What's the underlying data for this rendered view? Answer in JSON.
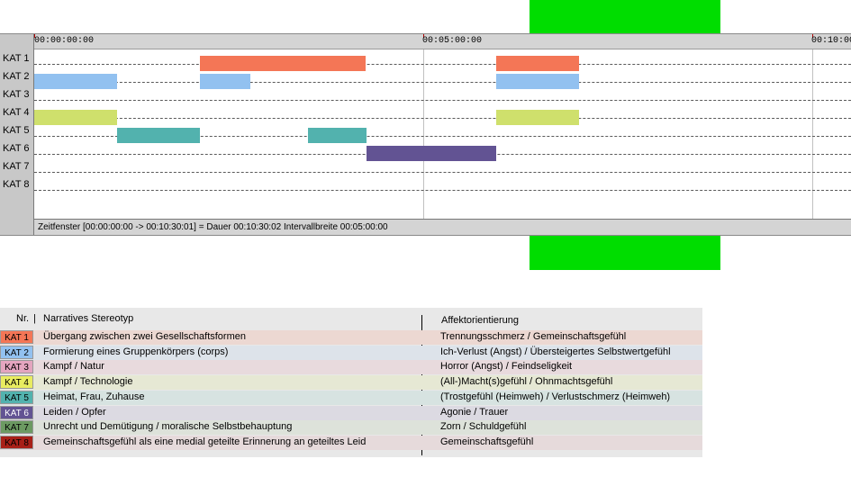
{
  "ruler": {
    "ticks": [
      "00:00:00:00",
      "00:05:00:00",
      "00:10:00:"
    ]
  },
  "rows": [
    "KAT 1",
    "KAT 2",
    "KAT 3",
    "KAT 4",
    "KAT 5",
    "KAT 6",
    "KAT 7",
    "KAT 8"
  ],
  "status": {
    "text": "Zeitfenster [00:00:00:00 -> 00:10:30:01] = Dauer 00:10:30:02     Intervallbreite 00:05:00:00"
  },
  "segments_seconds": {
    "KAT 1": [
      [
        128,
        256
      ],
      [
        356,
        420
      ]
    ],
    "KAT 2": [
      [
        0,
        64
      ],
      [
        128,
        167
      ],
      [
        356,
        420
      ]
    ],
    "KAT 4": [
      [
        0,
        64
      ],
      [
        356,
        420
      ]
    ],
    "KAT 5": [
      [
        64,
        128
      ],
      [
        211,
        256
      ]
    ],
    "KAT 6": [
      [
        256,
        356
      ]
    ]
  },
  "category_colors": {
    "KAT 1": "#f47656",
    "KAT 2": "#92c1f0",
    "KAT 4": "#cfe06c",
    "KAT 5": "#52b2ae",
    "KAT 6": "#625393"
  },
  "legend": {
    "header_nr": "Nr.",
    "header_stereotype": "Narratives Stereotyp",
    "header_affekt": "Affektorientierung",
    "rows": [
      {
        "kat": "KAT 1",
        "stereotype": "Übergang zwischen zwei Gesellschaftsformen",
        "affekt": "Trennungsschmerz / Gemeinschaftsgefühl",
        "badge": "#f47656",
        "tint": "#ecd8d2",
        "text": "#000000"
      },
      {
        "kat": "KAT 2",
        "stereotype": "Formierung eines Gruppenkörpers (corps)",
        "affekt": "Ich-Verlust (Angst) / Übersteigertes Selbstwertgefühl",
        "badge": "#92c1f0",
        "tint": "#dde3ea",
        "text": "#000000"
      },
      {
        "kat": "KAT 3",
        "stereotype": "Kampf / Natur",
        "affekt": "Horror (Angst) / Feindseligkeit",
        "badge": "#e4a5bf",
        "tint": "#e8dadd",
        "text": "#000000"
      },
      {
        "kat": "KAT 4",
        "stereotype": "Kampf / Technologie",
        "affekt": "(All-)Macht(s)gefühl / Ohnmachtsgefühl",
        "badge": "#e8ec60",
        "tint": "#e6e8d4",
        "text": "#000000"
      },
      {
        "kat": "KAT 5",
        "stereotype": "Heimat, Frau, Zuhause",
        "affekt": "(Trostgefühl (Heimweh) / Verlustschmerz (Heimweh)",
        "badge": "#52b2ae",
        "tint": "#d7e3e1",
        "text": "#000000"
      },
      {
        "kat": "KAT 6",
        "stereotype": "Leiden / Opfer",
        "affekt": "Agonie / Trauer",
        "badge": "#625393",
        "tint": "#dcdae2",
        "text": "#ffffff"
      },
      {
        "kat": "KAT 7",
        "stereotype": "Unrecht und Demütigung / moralische Selbstbehauptung",
        "affekt": "Zorn / Schuldgefühl",
        "badge": "#6c9a62",
        "tint": "#dde2da",
        "text": "#000000"
      },
      {
        "kat": "KAT 8",
        "stereotype": "Gemeinschaftsgefühl als eine medial geteilte Erinnerung an geteiltes Leid",
        "affekt": "Gemeinschaftsgefühl",
        "badge": "#a82018",
        "tint": "#e6dadb",
        "text": "#000000"
      }
    ]
  }
}
